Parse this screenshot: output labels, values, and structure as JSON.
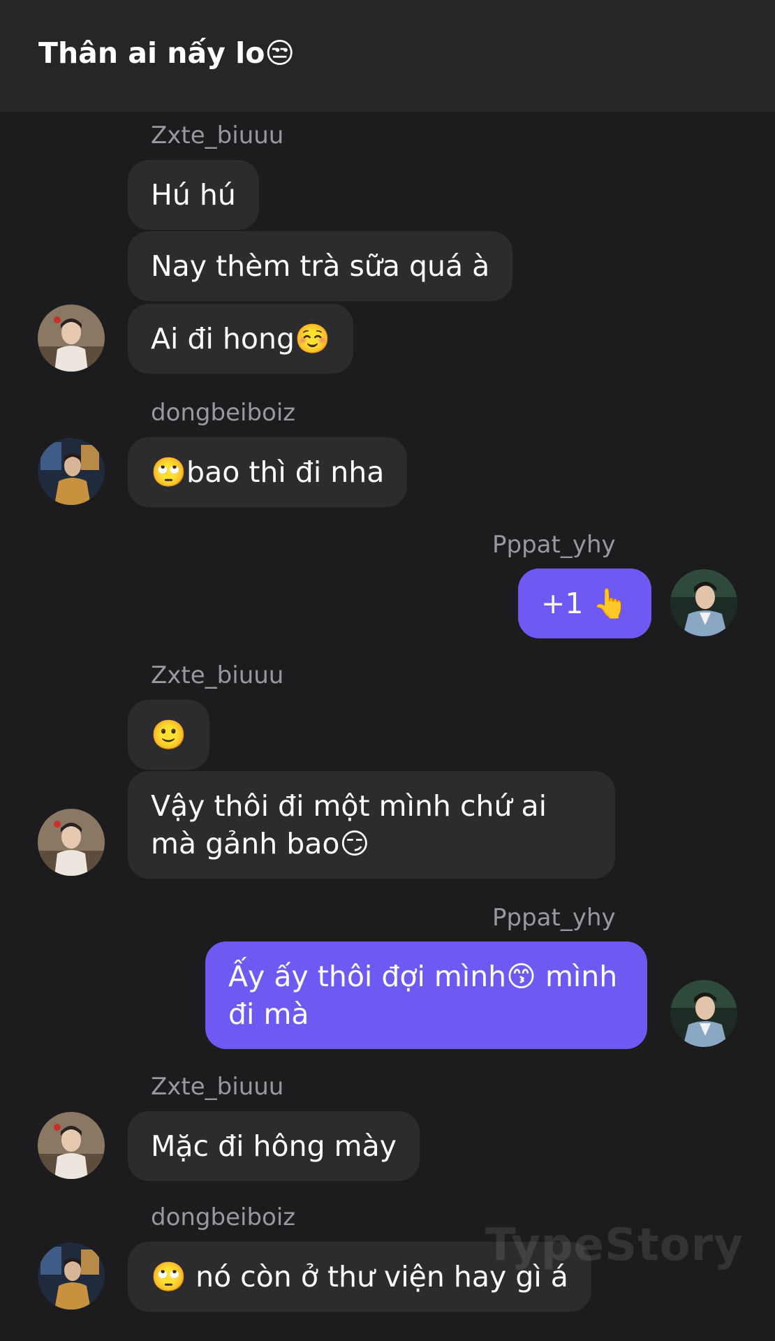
{
  "header": {
    "title": "Thân ai nấy lo😒"
  },
  "senders": {
    "zxte": "Zxte_biuuu",
    "dong": "dongbeiboiz",
    "pppat": "Pppat_yhy"
  },
  "messages": {
    "m1": "Hú hú",
    "m2": "Nay thèm trà sữa quá à",
    "m3": "Ai đi hong☺️",
    "m4": "🙄bao thì đi nha",
    "m5": "+1 👆",
    "m6": "🙂",
    "m7": "Vậy thôi đi một mình chứ ai mà gảnh bao😏",
    "m8": "Ấy ấy thôi đợi mình😙 mình đi mà",
    "m9": "Mặc đi hông mày",
    "m10": "🙄 nó còn ở thư viện hay gì á"
  },
  "watermark": "TypeStory",
  "colors": {
    "background": "#1c1c1e",
    "header": "#262628",
    "incoming_bubble": "#2c2c2e",
    "outgoing_bubble": "#6e5af2",
    "sender_name": "#98989f"
  }
}
